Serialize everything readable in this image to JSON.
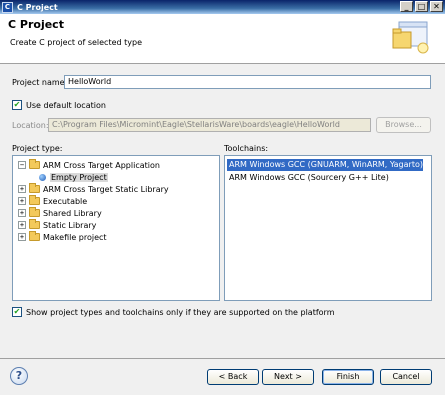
{
  "window": {
    "title": "C Project",
    "app_icon_letter": "C",
    "minimize": "_",
    "maximize": "□",
    "close": "✕"
  },
  "banner": {
    "title": "C Project",
    "description": "Create C project of selected type",
    "icon": "wizard-banner-icon"
  },
  "project_name": {
    "label": "Project name:",
    "value": "HelloWorld"
  },
  "default_location": {
    "label": "Use default location",
    "checked": true
  },
  "location": {
    "label": "Location:",
    "value": "C:\\Program Files\\Micromint\\Eagle\\StellarisWare\\boards\\eagle\\HelloWorld",
    "browse_label": "Browse..."
  },
  "project_type": {
    "label": "Project type:",
    "items": [
      {
        "label": "ARM Cross Target Application",
        "expander": "−",
        "icon": "folder-icon"
      },
      {
        "label": "Empty Project",
        "expander": "",
        "icon": "bullet-icon",
        "selected": true
      },
      {
        "label": "ARM Cross Target Static Library",
        "expander": "+",
        "icon": "folder-icon"
      },
      {
        "label": "Executable",
        "expander": "+",
        "icon": "folder-icon"
      },
      {
        "label": "Shared Library",
        "expander": "+",
        "icon": "folder-icon"
      },
      {
        "label": "Static Library",
        "expander": "+",
        "icon": "folder-icon"
      },
      {
        "label": "Makefile project",
        "expander": "+",
        "icon": "folder-icon"
      }
    ]
  },
  "toolchains": {
    "label": "Toolchains:",
    "items": [
      {
        "label": "ARM Windows GCC (GNUARM, WinARM, Yagarto)",
        "selected": true
      },
      {
        "label": "ARM Windows GCC (Sourcery G++ Lite)",
        "selected": false
      }
    ]
  },
  "filter_checkbox": {
    "label": "Show project types and toolchains only if they are supported on the platform",
    "checked": true
  },
  "footer": {
    "help": "?",
    "back": "< Back",
    "next": "Next >",
    "finish": "Finish",
    "cancel": "Cancel"
  },
  "colors": {
    "selection": "#316ac5",
    "title_bar": "#0a246a"
  }
}
